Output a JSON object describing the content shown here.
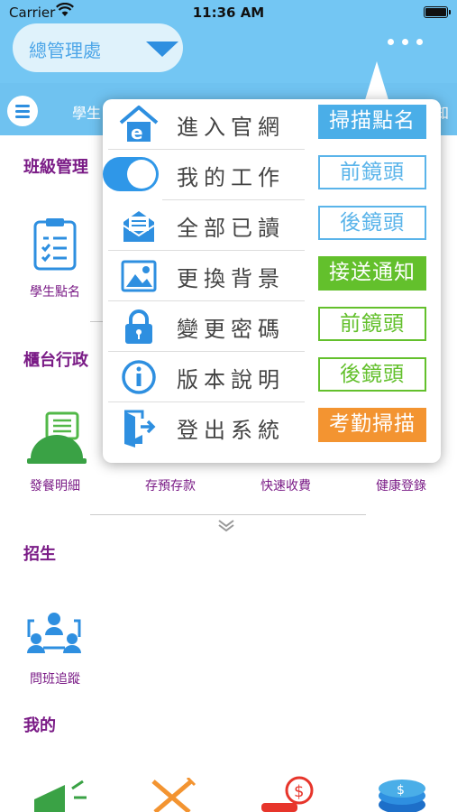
{
  "status_bar": {
    "carrier": "Carrier",
    "time": "11:36 AM"
  },
  "header": {
    "dept_selector": "總管理處",
    "tab_left": "學生",
    "tab_right": "知"
  },
  "sections": {
    "class_management": {
      "title": "班級管理",
      "items": [
        {
          "label": "學生點名",
          "icon": "clipboard-checklist-icon"
        }
      ]
    },
    "front_desk": {
      "title": "櫃台行政",
      "items": [
        {
          "label": "發餐明細",
          "icon": "food-cloche-icon"
        },
        {
          "label": "存預存款"
        },
        {
          "label": "快速收費"
        },
        {
          "label": "健康登錄"
        }
      ]
    },
    "admissions": {
      "title": "招生",
      "items": [
        {
          "label": "問班追蹤",
          "icon": "people-network-icon"
        }
      ]
    },
    "mine": {
      "title": "我的",
      "items": [
        {
          "icon": "megaphone-icon"
        },
        {
          "icon": "fork-knife-icon"
        },
        {
          "icon": "dollar-coin-icon"
        },
        {
          "icon": "coin-stack-icon"
        }
      ]
    }
  },
  "popup_menu": {
    "items": [
      {
        "label": "進入官網",
        "icon": "home-web-icon",
        "action": "掃描點名",
        "action_style": "filled",
        "action_color": "#4aaee8"
      },
      {
        "label": "我的工作",
        "icon": "toggle-switch",
        "action": "前鏡頭",
        "action_style": "outline",
        "action_color": "#5ab4ea"
      },
      {
        "label": "全部已讀",
        "icon": "mail-open-icon",
        "action": "後鏡頭",
        "action_style": "outline",
        "action_color": "#5ab4ea"
      },
      {
        "label": "更換背景",
        "icon": "image-icon",
        "action": "接送通知",
        "action_style": "filled",
        "action_color": "#63c02c"
      },
      {
        "label": "變更密碼",
        "icon": "lock-icon",
        "action": "前鏡頭",
        "action_style": "outline",
        "action_color": "#63c02c"
      },
      {
        "label": "版本說明",
        "icon": "info-icon",
        "action": "後鏡頭",
        "action_style": "outline",
        "action_color": "#63c02c"
      },
      {
        "label": "登出系統",
        "icon": "logout-door-icon",
        "action": "考勤掃描",
        "action_style": "filled",
        "action_color": "#f39431"
      }
    ]
  },
  "colors": {
    "header": "#73c6f3",
    "section_title": "#7a1b86",
    "accent_blue": "#2e8fe0"
  }
}
